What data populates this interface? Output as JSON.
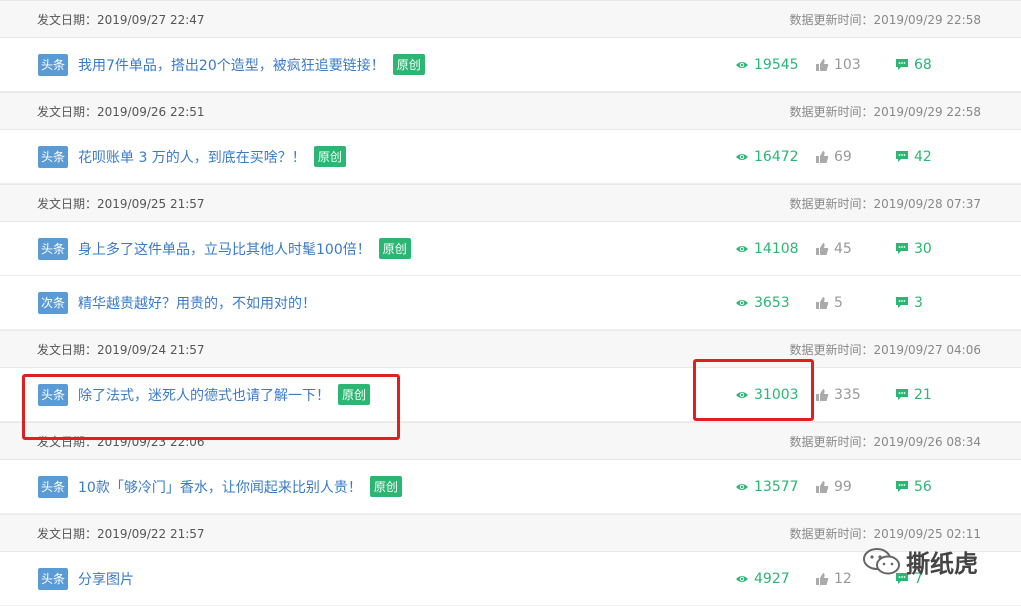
{
  "rows": [
    {
      "type": "date",
      "post_date": "发文日期：2019/09/27 22:47",
      "update": "数据更新时间：2019/09/29 22:58"
    },
    {
      "type": "article",
      "badge": "头条",
      "title": "我用7件单品，搭出20个造型，被疯狂追要链接！",
      "original": "原创",
      "views": "19545",
      "likes": "103",
      "comments": "68"
    },
    {
      "type": "date",
      "post_date": "发文日期：2019/09/26 22:51",
      "update": "数据更新时间：2019/09/29 22:58"
    },
    {
      "type": "article",
      "badge": "头条",
      "title": "花呗账单 3 万的人，到底在买啥？！",
      "original": "原创",
      "views": "16472",
      "likes": "69",
      "comments": "42"
    },
    {
      "type": "date",
      "post_date": "发文日期：2019/09/25 21:57",
      "update": "数据更新时间：2019/09/28 07:37"
    },
    {
      "type": "article",
      "badge": "头条",
      "title": "身上多了这件单品，立马比其他人时髦100倍！",
      "original": "原创",
      "views": "14108",
      "likes": "45",
      "comments": "30"
    },
    {
      "type": "article",
      "badge": "次条",
      "title": "精华越贵越好？用贵的，不如用对的！",
      "original": "",
      "views": "3653",
      "likes": "5",
      "comments": "3"
    },
    {
      "type": "date",
      "post_date": "发文日期：2019/09/24 21:57",
      "update": "数据更新时间：2019/09/27 04:06"
    },
    {
      "type": "article",
      "badge": "头条",
      "title": "除了法式，迷死人的德式也请了解一下！",
      "original": "原创",
      "views": "31003",
      "likes": "335",
      "comments": "21"
    },
    {
      "type": "date",
      "post_date": "发文日期：2019/09/23 22:06",
      "update": "数据更新时间：2019/09/26 08:34"
    },
    {
      "type": "article",
      "badge": "头条",
      "title": "10款「够冷门」香水，让你闻起来比别人贵！",
      "original": "原创",
      "views": "13577",
      "likes": "99",
      "comments": "56"
    },
    {
      "type": "date",
      "post_date": "发文日期：2019/09/22 21:57",
      "update": "数据更新时间：2019/09/25 02:11"
    },
    {
      "type": "article",
      "badge": "头条",
      "title": "分享图片",
      "original": "",
      "views": "4927",
      "likes": "12",
      "comments": "7"
    }
  ],
  "watermark": {
    "text": "撕纸虎"
  },
  "colors": {
    "accent_green": "#2bb673",
    "link_blue": "#3a7bc8",
    "badge_blue": "#5b9bd5",
    "highlight_red": "#e02020"
  }
}
